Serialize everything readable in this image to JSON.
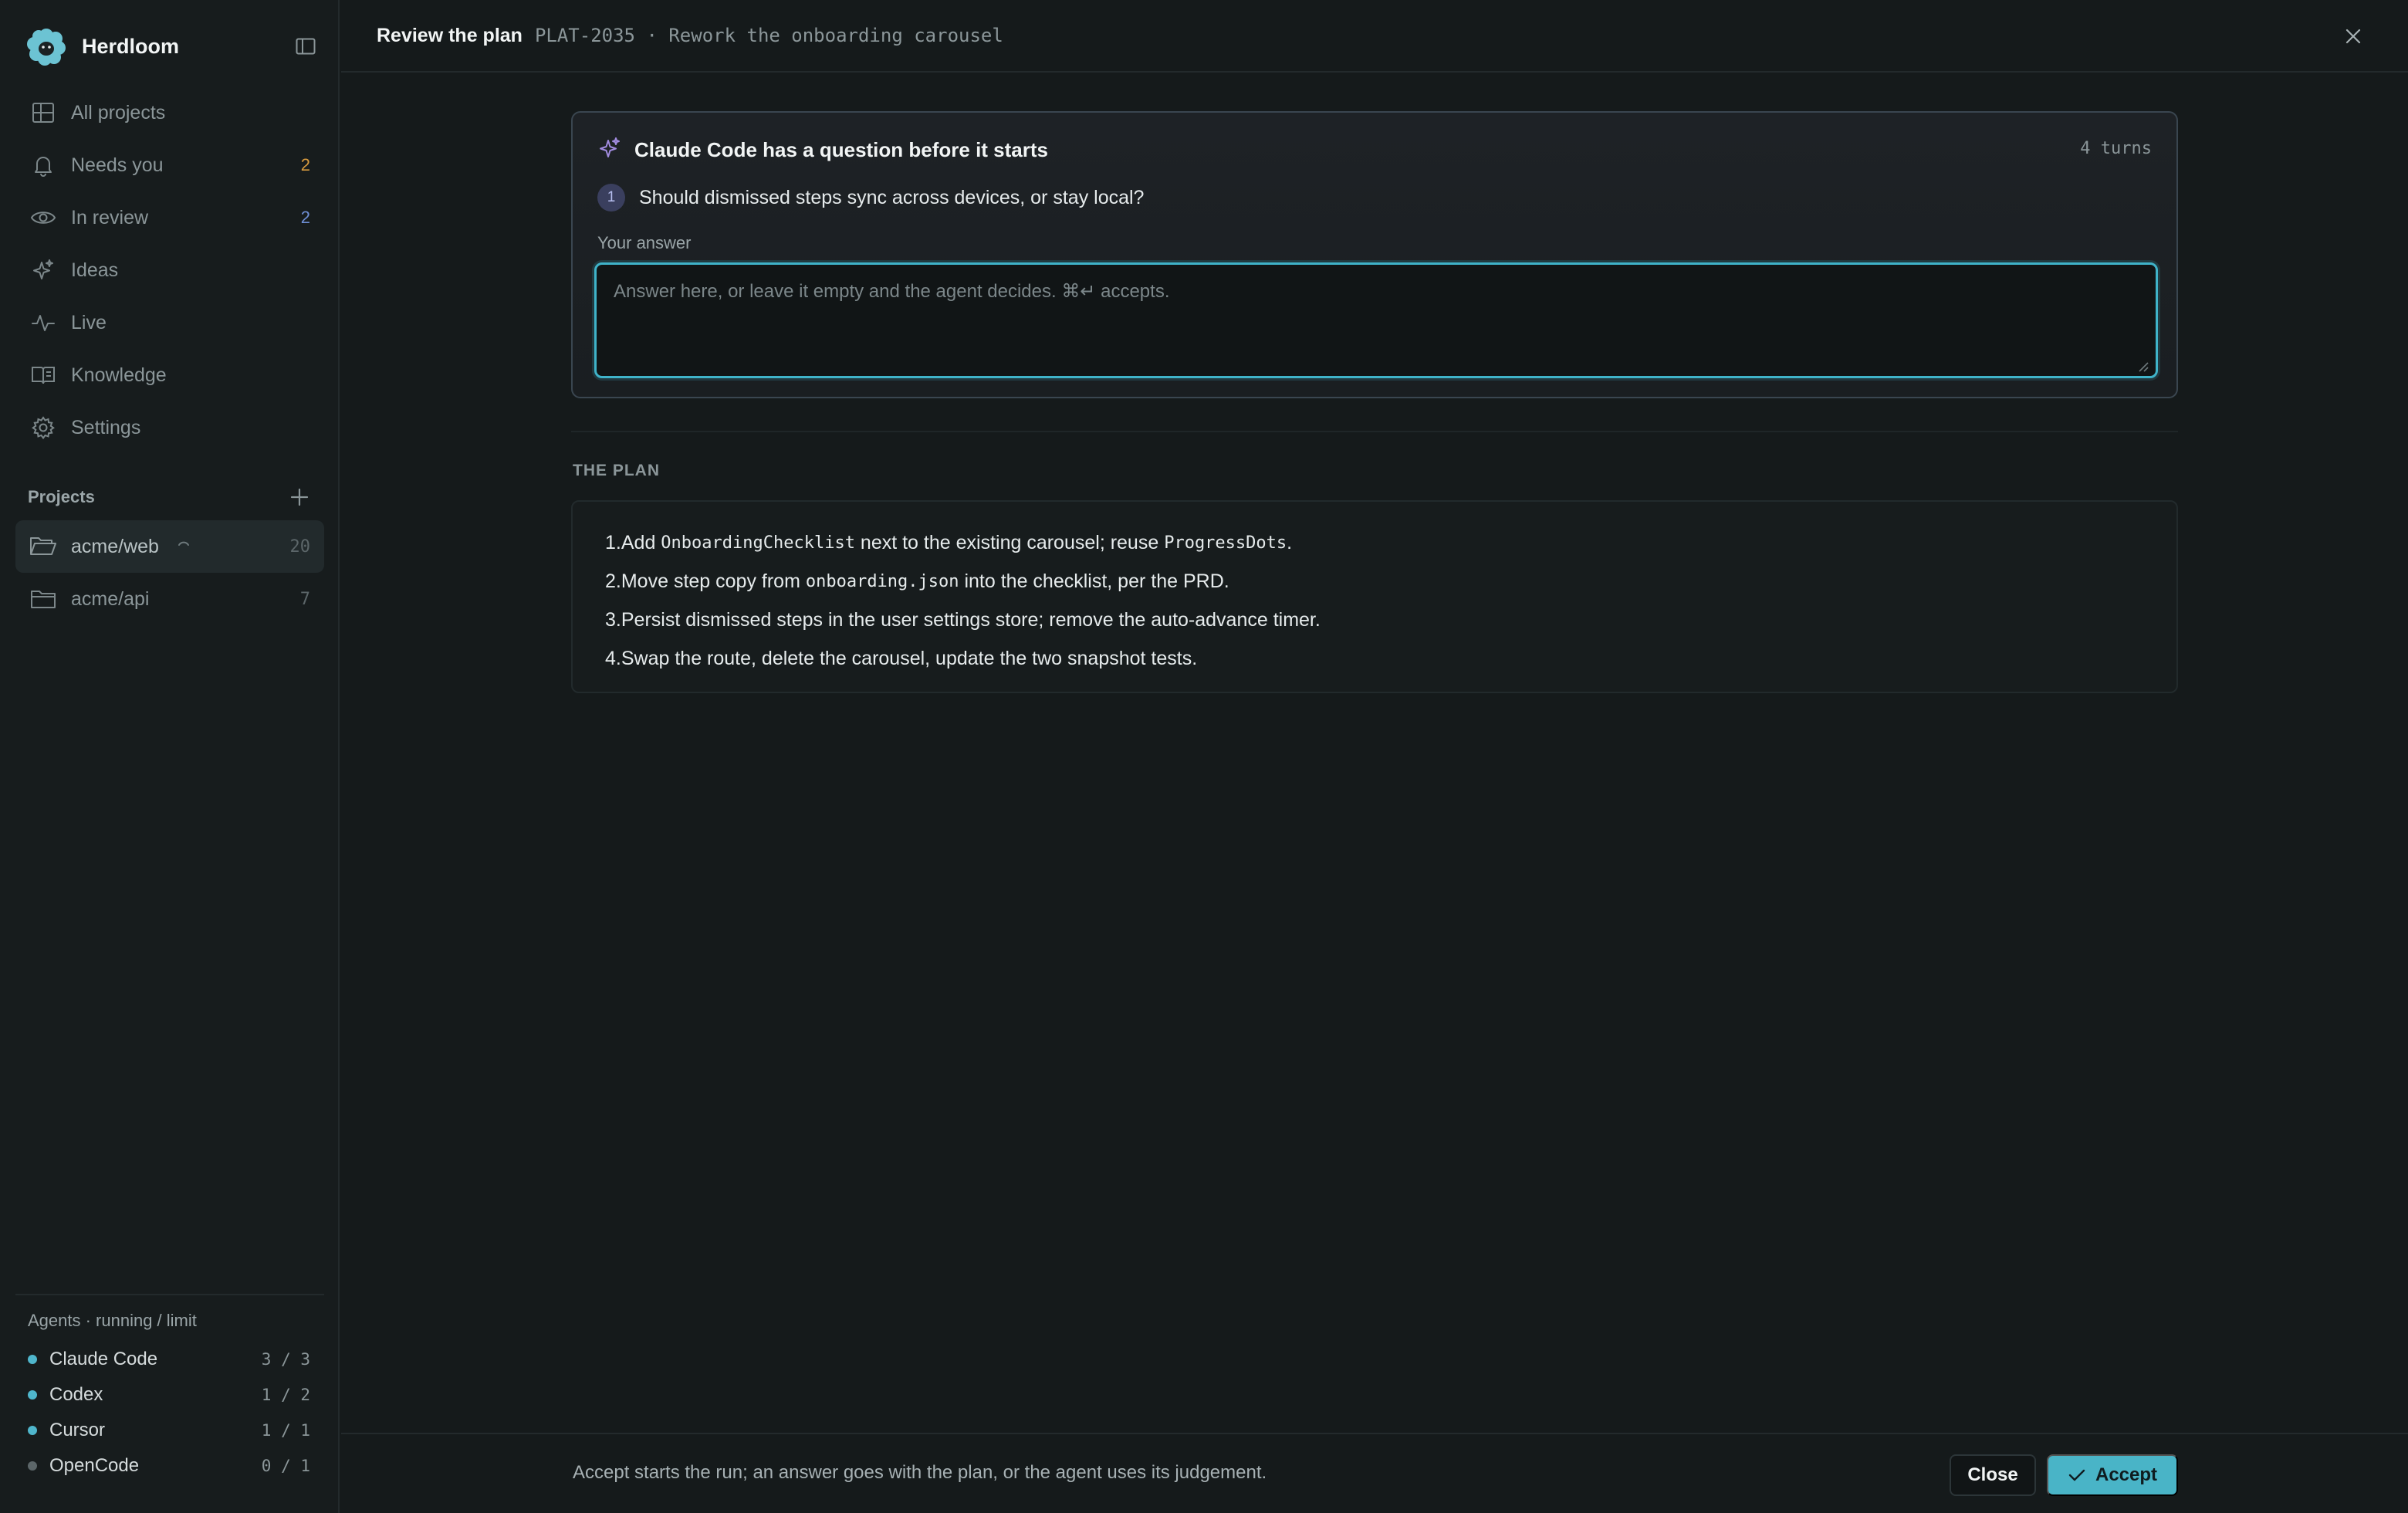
{
  "app": {
    "name": "Herdloom",
    "logo_icon": "sheep-logo-icon",
    "collapse_icon": "sidebar-toggle-icon"
  },
  "sidebar": {
    "nav": [
      {
        "label": "All projects",
        "icon": "grid-icon",
        "count": ""
      },
      {
        "label": "Needs you",
        "icon": "bell-icon",
        "count": "2",
        "count_color": "#d79a3e"
      },
      {
        "label": "In review",
        "icon": "eye-icon",
        "count": "2",
        "count_color": "#6f8fd6"
      },
      {
        "label": "Ideas",
        "icon": "sparkle-icon",
        "count": ""
      },
      {
        "label": "Live",
        "icon": "activity-icon",
        "count": ""
      },
      {
        "label": "Knowledge",
        "icon": "book-icon",
        "count": ""
      },
      {
        "label": "Settings",
        "icon": "gear-icon",
        "count": ""
      }
    ],
    "projects_title": "Projects",
    "projects": [
      {
        "label": "acme/web",
        "count": "20",
        "active": true,
        "loading": true
      },
      {
        "label": "acme/api",
        "count": "7",
        "active": false,
        "loading": false
      }
    ],
    "agents_title": "Agents · running / limit",
    "agents": [
      {
        "name": "Claude Code",
        "usage": "3 / 3",
        "status_color": "#4fb6cc"
      },
      {
        "name": "Codex",
        "usage": "1 / 2",
        "status_color": "#4fb6cc"
      },
      {
        "name": "Cursor",
        "usage": "1 / 1",
        "status_color": "#4fb6cc"
      },
      {
        "name": "OpenCode",
        "usage": "0 / 1",
        "status_color": "#5c6669"
      }
    ]
  },
  "header": {
    "title": "Review the plan",
    "ticket": "PLAT-2035 · Rework the onboarding carousel"
  },
  "question": {
    "title": "Claude Code has a question before it starts",
    "turns": "4 turns",
    "number": "1",
    "text": "Should dismissed steps sync across devices, or stay local?",
    "answer_label": "Your answer",
    "answer_value": "",
    "answer_placeholder": "Answer here, or leave it empty and the agent decides. ⌘↵ accepts."
  },
  "plan": {
    "label": "THE PLAN",
    "steps": [
      {
        "n": "1.",
        "a": "Add ",
        "code1": "OnboardingChecklist",
        "b": " next to the existing carousel; reuse ",
        "code2": "ProgressDots",
        "c": "."
      },
      {
        "n": "2.",
        "a": "Move step copy from ",
        "code1": "onboarding.json",
        "b": " into the checklist, per the PRD.",
        "code2": "",
        "c": ""
      },
      {
        "n": "3.",
        "a": "Persist dismissed steps in the user settings store; remove the auto-advance timer.",
        "code1": "",
        "b": "",
        "code2": "",
        "c": ""
      },
      {
        "n": "4.",
        "a": "Swap the route, delete the carousel, update the two snapshot tests.",
        "code1": "",
        "b": "",
        "code2": "",
        "c": ""
      }
    ]
  },
  "footer": {
    "text": "Accept starts the run; an answer goes with the plan, or the agent uses its judgement.",
    "close_label": "Close",
    "accept_label": "Accept"
  },
  "colors": {
    "accent": "#49b4c7",
    "focus_ring": "#3fb3c9"
  }
}
